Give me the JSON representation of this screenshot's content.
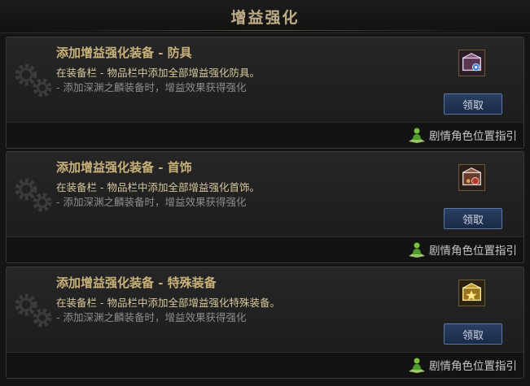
{
  "header": {
    "title": "增益强化"
  },
  "quests": [
    {
      "title": "添加增益强化装备 - 防具",
      "desc1": "在装备栏 - 物品栏中添加全部增益强化防具。",
      "desc2": "- 添加深渊之麟装备时，增益效果获得强化",
      "icon": "armor-box-icon",
      "claim_label": "领取",
      "guide_label": "剧情角色位置指引"
    },
    {
      "title": "添加增益强化装备 - 首饰",
      "desc1": "在装备栏 - 物品栏中添加全部增益强化首饰。",
      "desc2": "- 添加深渊之麟装备时，增益效果获得强化",
      "icon": "accessory-box-icon",
      "claim_label": "领取",
      "guide_label": "剧情角色位置指引"
    },
    {
      "title": "添加增益强化装备 - 特殊装备",
      "desc1": "在装备栏 - 物品栏中添加全部增益强化特殊装备。",
      "desc2": "- 添加深渊之麟装备时，增益效果获得强化",
      "icon": "special-box-icon",
      "claim_label": "领取",
      "guide_label": "剧情角色位置指引"
    }
  ]
}
